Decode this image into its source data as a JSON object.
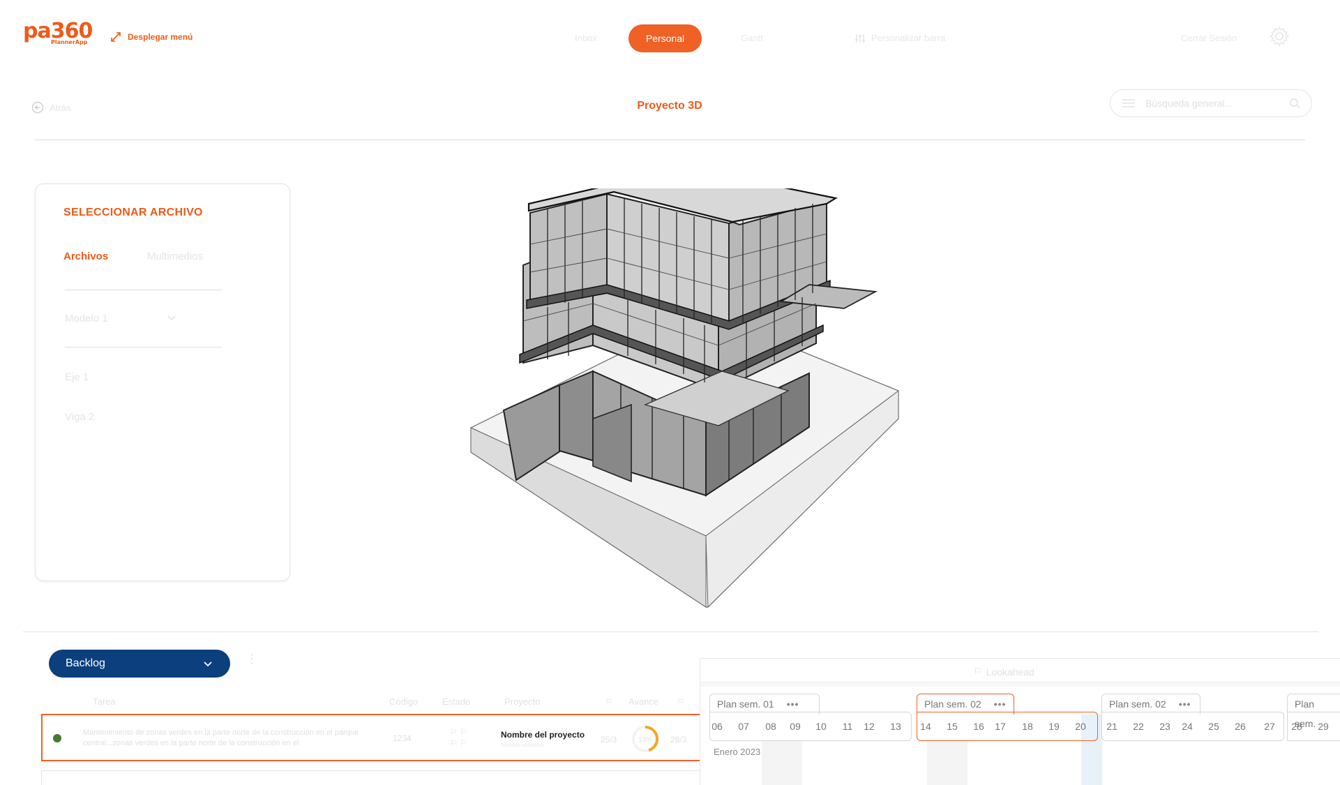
{
  "header": {
    "logo_text": "pa360",
    "logo_sub": "PlannerApp",
    "expand_menu_label": "Desplegar menú",
    "nav": {
      "inbox": "Inbox",
      "personal": "Personal",
      "gantt": "Gantt",
      "personalize": "Personalizar barra",
      "logout": "Cerrar Sesión"
    }
  },
  "subheader": {
    "back_label": "Atrás",
    "title": "Proyecto 3D",
    "search_placeholder": "Búsqueda general..."
  },
  "file_panel": {
    "title": "SELECCIONAR ARCHIVO",
    "tabs": [
      "Archivos",
      "Multimedios"
    ],
    "model_select": "Modelo 1",
    "items": [
      "Eje 1",
      "Viga 2"
    ]
  },
  "backlog": {
    "dropdown_label": "Backlog",
    "columns": {
      "task": "Tarea",
      "code": "Código",
      "status": "Estado",
      "project": "Proyecto",
      "progress": "Avance"
    },
    "rows": [
      {
        "text": "Mantenimiento de zonas verdes en la parte norte de la construcción en el parque central...zonas verdes en la parte norte de la construcción en el",
        "code": "1234",
        "project": "Nombre del proyecto",
        "project_sub": "Nombre subtexto",
        "start": "25/3",
        "end": "28/3",
        "progress": "15%",
        "progress_fraction": 0.45,
        "status_color": "#47782e"
      }
    ]
  },
  "lookahead": {
    "title": "Lookahead",
    "weeks": [
      {
        "label": "Plan sem. 01",
        "days": [
          "06",
          "07",
          "08",
          "09",
          "10",
          "11",
          "12",
          "13"
        ]
      },
      {
        "label": "Plan sem. 02",
        "days": [
          "14",
          "15",
          "16",
          "17",
          "18",
          "19",
          "20"
        ]
      },
      {
        "label": "Plan sem. 02",
        "days": [
          "21",
          "22",
          "23",
          "24",
          "25",
          "26",
          "27"
        ]
      },
      {
        "label": "Plan sem.",
        "days": [
          "28",
          "29"
        ]
      }
    ],
    "month": "Enero 2023"
  },
  "colors": {
    "accent": "#ef6124",
    "backlog_blue": "#0b3f7d",
    "status_green": "#47782e"
  }
}
